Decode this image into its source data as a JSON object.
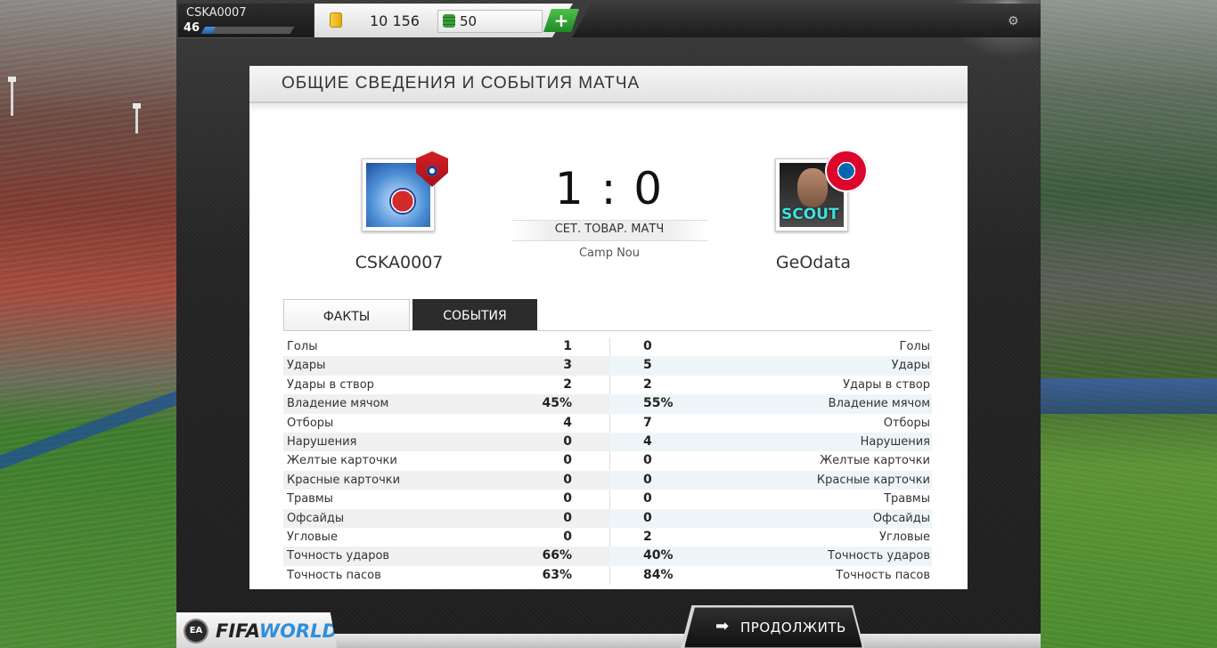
{
  "profile": {
    "name": "CSKA0007",
    "level": "46",
    "xp_progress": 0.12
  },
  "currency": {
    "coins": "10 156",
    "fifa_points": "50",
    "add_label": "+"
  },
  "panel": {
    "title": "ОБЩИЕ СВЕДЕНИЯ И СОБЫТИЯ МАТЧА"
  },
  "match": {
    "home_team": "CSKA0007",
    "away_team": "GeOdata",
    "score": "1 : 0",
    "type": "СЕТ. ТОВАР. МАТЧ",
    "stadium": "Camp Nou"
  },
  "tabs": [
    {
      "label": "ФАКТЫ",
      "active": true
    },
    {
      "label": "СОБЫТИЯ",
      "active": false
    }
  ],
  "stats": [
    {
      "label": "Голы",
      "home": "1",
      "away": "0"
    },
    {
      "label": "Удары",
      "home": "3",
      "away": "5"
    },
    {
      "label": "Удары в створ",
      "home": "2",
      "away": "2"
    },
    {
      "label": "Владение мячом",
      "home": "45%",
      "away": "55%"
    },
    {
      "label": "Отборы",
      "home": "4",
      "away": "7"
    },
    {
      "label": "Нарушения",
      "home": "0",
      "away": "4"
    },
    {
      "label": "Желтые карточки",
      "home": "0",
      "away": "0"
    },
    {
      "label": "Красные карточки",
      "home": "0",
      "away": "0"
    },
    {
      "label": "Травмы",
      "home": "0",
      "away": "0"
    },
    {
      "label": "Офсайды",
      "home": "0",
      "away": "0"
    },
    {
      "label": "Угловые",
      "home": "0",
      "away": "2"
    },
    {
      "label": "Точность ударов",
      "home": "66%",
      "away": "40%"
    },
    {
      "label": "Точность пасов",
      "home": "63%",
      "away": "84%"
    }
  ],
  "footer": {
    "continue_label": "ПРОДОЛЖИТЬ",
    "logo_fifa": "FIFA",
    "logo_world": "WORLD",
    "ea_label": "EA"
  },
  "badges": {
    "away_overlay": "SCOUT"
  },
  "colors": {
    "accent_green": "#2e9e35",
    "xp_blue": "#3a7cc9",
    "dark_tab": "#2c2c2c"
  }
}
